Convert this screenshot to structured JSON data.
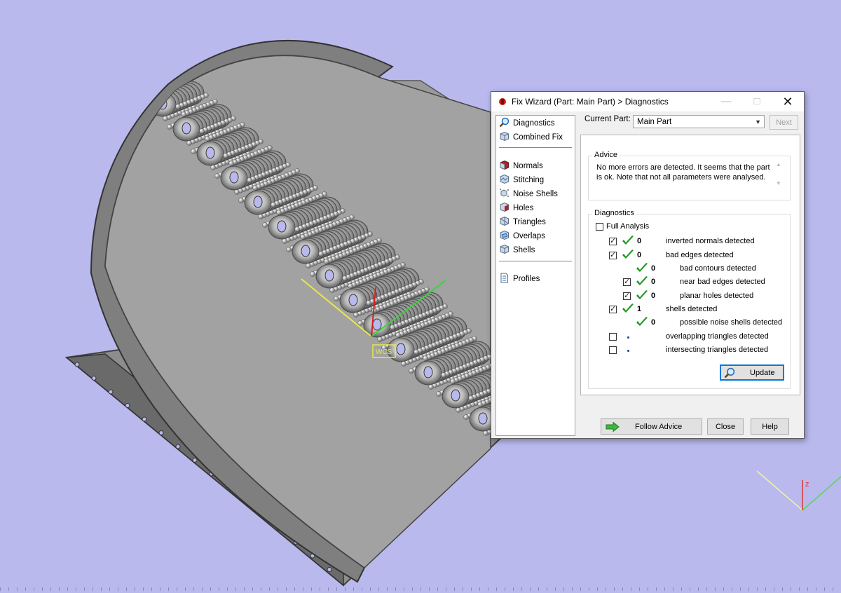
{
  "dialog": {
    "title": "Fix Wizard (Part: Main Part) > Diagnostics",
    "current_part_label": "Current Part:",
    "current_part_value": "Main Part",
    "next_label": "Next",
    "follow_advice_label": "Follow Advice",
    "close_label": "Close",
    "help_label": "Help"
  },
  "nav": {
    "items": [
      {
        "label": "Diagnostics",
        "icon": "magnifier-icon"
      },
      {
        "label": "Combined Fix",
        "icon": "cube-icon"
      },
      {
        "label": "Normals",
        "icon": "normals-cube-icon"
      },
      {
        "label": "Stitching",
        "icon": "stitching-cube-icon"
      },
      {
        "label": "Noise Shells",
        "icon": "noise-shells-icon"
      },
      {
        "label": "Holes",
        "icon": "holes-cube-icon"
      },
      {
        "label": "Triangles",
        "icon": "triangles-cube-icon"
      },
      {
        "label": "Overlaps",
        "icon": "overlaps-cube-icon"
      },
      {
        "label": "Shells",
        "icon": "shells-cube-icon"
      },
      {
        "label": "Profiles",
        "icon": "document-icon"
      }
    ]
  },
  "advice": {
    "title": "Advice",
    "text": "No more errors are detected. It seems that the part is ok. Note that not all parameters were analysed."
  },
  "diagnostics": {
    "title": "Diagnostics",
    "full_analysis_label": "Full Analysis",
    "update_label": "Update",
    "rows": [
      {
        "label": "inverted normals detected",
        "value": "0",
        "checked": true,
        "status": "ok"
      },
      {
        "label": "bad edges detected",
        "value": "0",
        "checked": true,
        "status": "ok"
      },
      {
        "label": "bad contours detected",
        "value": "0",
        "checked": null,
        "status": "ok"
      },
      {
        "label": "near bad edges detected",
        "value": "0",
        "checked": true,
        "status": "ok"
      },
      {
        "label": "planar holes detected",
        "value": "0",
        "checked": true,
        "status": "ok"
      },
      {
        "label": "shells detected",
        "value": "1",
        "checked": true,
        "status": "ok"
      },
      {
        "label": "possible noise shells detected",
        "value": "0",
        "checked": null,
        "status": "ok"
      },
      {
        "label": "overlapping triangles detected",
        "value": "",
        "checked": false,
        "status": "unknown"
      },
      {
        "label": "intersecting triangles detected",
        "value": "",
        "checked": false,
        "status": "unknown"
      }
    ]
  },
  "viewport": {
    "background": "#b9b9ee",
    "axis_label": "z",
    "ucs_label": "WCS"
  },
  "colors": {
    "accent": "#0078d7",
    "ok_check": "#1a9a1a",
    "title_icon": "#c0241b"
  }
}
